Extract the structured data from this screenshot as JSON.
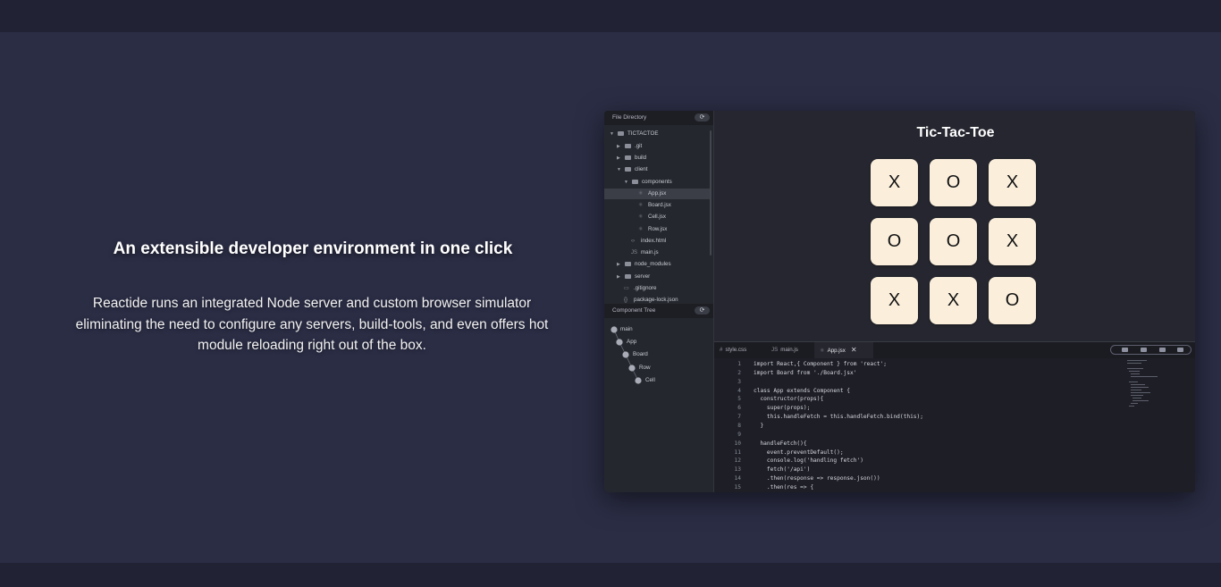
{
  "hero": {
    "title": "An extensible developer environment in one click",
    "description": "Reactide runs an integrated Node server and custom browser simulator eliminating the need to configure any servers, build-tools, and even offers hot module reloading right out of the box."
  },
  "app": {
    "file_directory": {
      "header": "File Directory",
      "refresh_icon": "refresh-icon",
      "items": [
        {
          "label": "TICTACTOE",
          "kind": "folder",
          "expanded": true
        },
        {
          "label": ".git",
          "kind": "folder",
          "expanded": false
        },
        {
          "label": "build",
          "kind": "folder",
          "expanded": false
        },
        {
          "label": "client",
          "kind": "folder",
          "expanded": true
        },
        {
          "label": "components",
          "kind": "folder",
          "expanded": true
        },
        {
          "label": "App.jsx",
          "kind": "jsx",
          "selected": true
        },
        {
          "label": "Board.jsx",
          "kind": "jsx"
        },
        {
          "label": "Cell.jsx",
          "kind": "jsx"
        },
        {
          "label": "Row.jsx",
          "kind": "jsx"
        },
        {
          "label": "index.html",
          "kind": "html"
        },
        {
          "label": "main.js",
          "kind": "js"
        },
        {
          "label": "node_modules",
          "kind": "folder",
          "expanded": false
        },
        {
          "label": "server",
          "kind": "folder",
          "expanded": false
        },
        {
          "label": ".gitignore",
          "kind": "file"
        },
        {
          "label": "package-lock.json",
          "kind": "json"
        }
      ]
    },
    "component_tree": {
      "header": "Component Tree",
      "nodes": [
        "main",
        "App",
        "Board",
        "Row",
        "Cell"
      ]
    },
    "preview": {
      "title": "Tic-Tac-Toe",
      "board": [
        [
          "X",
          "O",
          "X"
        ],
        [
          "O",
          "O",
          "X"
        ],
        [
          "X",
          "X",
          "O"
        ]
      ]
    },
    "editor": {
      "tabs": [
        {
          "icon": "#",
          "label": "style.css",
          "active": false
        },
        {
          "icon": "JS",
          "label": "main.js",
          "active": false
        },
        {
          "icon": "⚛",
          "label": "App.jsx",
          "active": true,
          "close": "✕"
        }
      ],
      "toolbar_icons": [
        "terminal-icon",
        "browser-icon",
        "device-icon",
        "save-icon"
      ],
      "code_lines": [
        {
          "n": "1",
          "text": "import React,{ Component } from 'react';"
        },
        {
          "n": "2",
          "text": "import Board from './Board.jsx'"
        },
        {
          "n": "3",
          "text": ""
        },
        {
          "n": "4",
          "text": "class App extends Component {"
        },
        {
          "n": "5",
          "text": "  constructor(props){"
        },
        {
          "n": "6",
          "text": "    super(props);"
        },
        {
          "n": "7",
          "text": "    this.handleFetch = this.handleFetch.bind(this);"
        },
        {
          "n": "8",
          "text": "  }"
        },
        {
          "n": "9",
          "text": ""
        },
        {
          "n": "10",
          "text": "  handleFetch(){"
        },
        {
          "n": "11",
          "text": "    event.preventDefault();"
        },
        {
          "n": "12",
          "text": "    console.log('handling fetch')"
        },
        {
          "n": "13",
          "text": "    fetch('/api')"
        },
        {
          "n": "14",
          "text": "    .then(response => response.json())"
        },
        {
          "n": "15",
          "text": "    .then(res => {"
        }
      ]
    }
  }
}
